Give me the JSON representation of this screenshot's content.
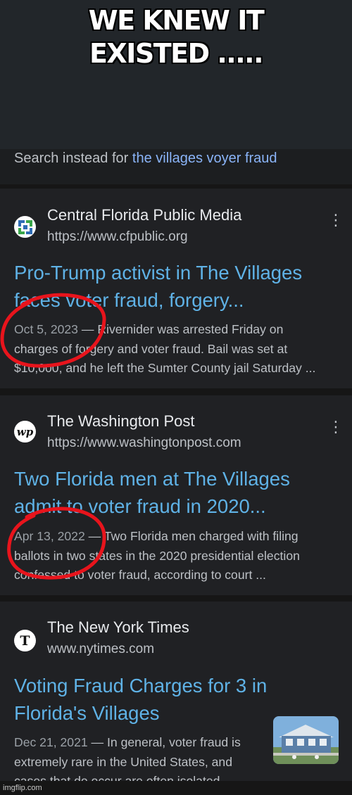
{
  "meme": {
    "caption": "WE KNEW IT\nEXISTED .....",
    "watermark": "imgflip.com"
  },
  "suggestion": {
    "prefix": "Search instead for",
    "query": "the villages voyer fraud"
  },
  "results": [
    {
      "source": "Central Florida Public Media",
      "url": "https://www.cfpublic.org",
      "title": "Pro-Trump activist in The Villages\nfaces voter fraud, forgery...",
      "date": "Oct 5, 2023",
      "snippet": " — Rivernider was arrested Friday on\ncharges of forgery and voter fraud. Bail was set at\n$10,000, and he left the Sumter County jail Saturday ...",
      "favicon_icon": "cfpublic-logo-icon"
    },
    {
      "source": "The Washington Post",
      "url": "https://www.washingtonpost.com",
      "title": "Two Florida men at The Villages\nadmit to voter fraud in 2020...",
      "date": "Apr 13, 2022",
      "snippet": " — Two Florida men charged with filing\nballots in two states in the 2020 presidential election\nconfessed to voter fraud, according to court ...",
      "favicon_icon": "wp-logo-icon",
      "favicon_text": "wp"
    },
    {
      "source": "The New York Times",
      "url": "www.nytimes.com",
      "title": "Voting Fraud Charges for 3 in\nFlorida's Villages",
      "date": "Dec 21, 2021",
      "snippet": " — In general, voter fraud is\nextremely rare in the United States, and\ncases that do occur are often isolated",
      "favicon_icon": "nyt-logo-icon",
      "favicon_text": "T"
    }
  ],
  "menu_icon": "more-vert-icon",
  "colors": {
    "link_blue": "#5fb2e6",
    "annotation_red": "#e8141c",
    "card_bg": "#202124"
  }
}
